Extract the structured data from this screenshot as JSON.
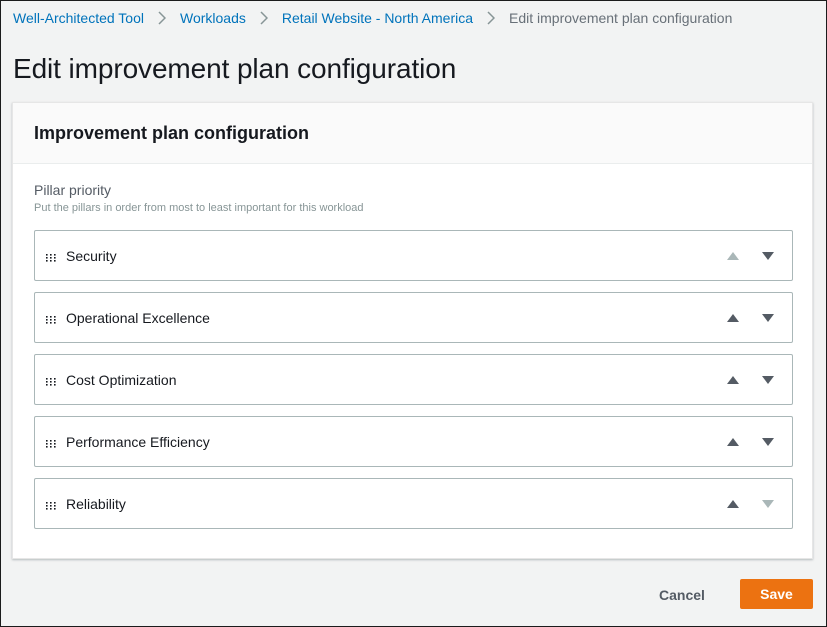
{
  "breadcrumb": [
    {
      "label": "Well-Architected Tool",
      "link": true
    },
    {
      "label": "Workloads",
      "link": true
    },
    {
      "label": "Retail Website - North America",
      "link": true
    },
    {
      "label": "Edit improvement plan configuration",
      "link": false
    }
  ],
  "page_title": "Edit improvement plan configuration",
  "panel": {
    "title": "Improvement plan configuration",
    "field_label": "Pillar priority",
    "field_description": "Put the pillars in order from most to least important for this workload",
    "pillars": [
      {
        "label": "Security",
        "up_enabled": false,
        "down_enabled": true
      },
      {
        "label": "Operational Excellence",
        "up_enabled": true,
        "down_enabled": true
      },
      {
        "label": "Cost Optimization",
        "up_enabled": true,
        "down_enabled": true
      },
      {
        "label": "Performance Efficiency",
        "up_enabled": true,
        "down_enabled": true
      },
      {
        "label": "Reliability",
        "up_enabled": true,
        "down_enabled": false
      }
    ]
  },
  "actions": {
    "cancel_label": "Cancel",
    "save_label": "Save"
  },
  "colors": {
    "link": "#0073bb",
    "primary_button": "#ec7211",
    "arrow_enabled": "#545b64",
    "arrow_disabled": "#aab7b8"
  },
  "icons": {
    "separator": "chevron-right-icon",
    "drag": "drag-handle-icon",
    "up": "caret-up-icon",
    "down": "caret-down-icon"
  }
}
